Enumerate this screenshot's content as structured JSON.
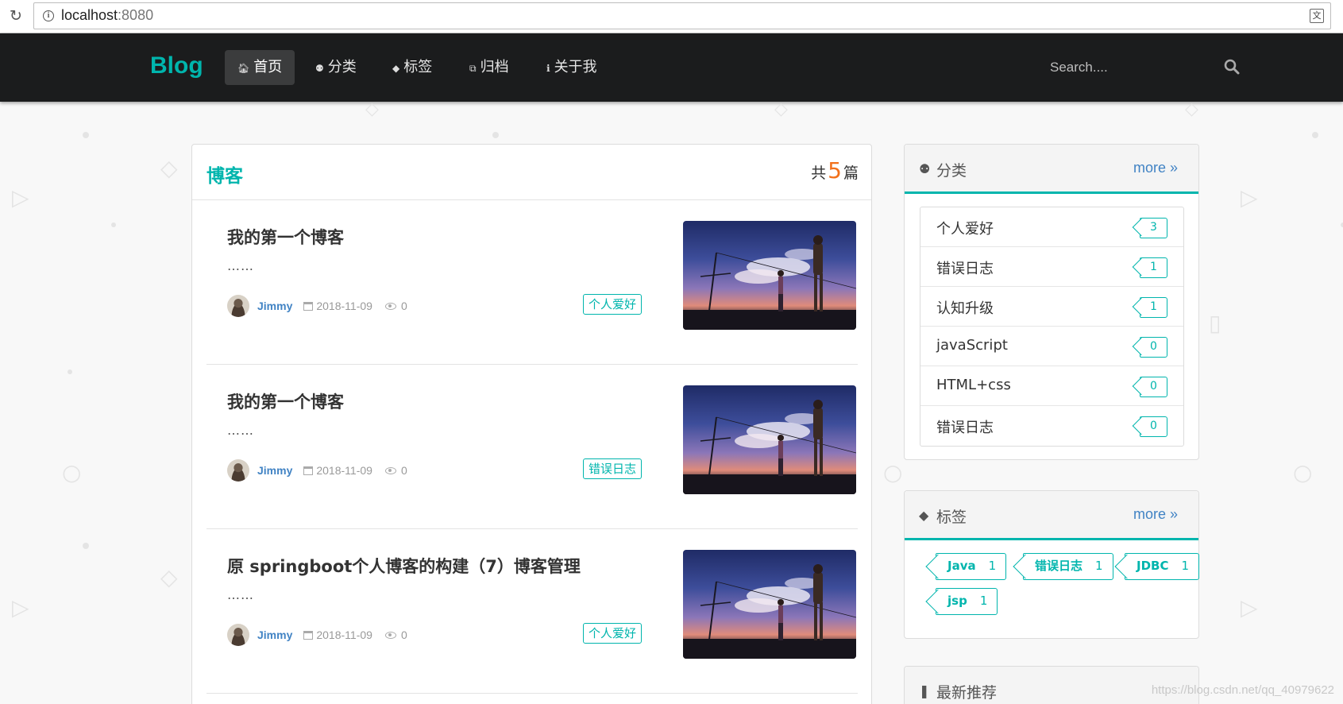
{
  "browser": {
    "url_host": "localhost",
    "url_port": ":8080"
  },
  "nav": {
    "brand": "Blog",
    "items": [
      {
        "label": "首页",
        "icon": "home-icon",
        "active": true
      },
      {
        "label": "分类",
        "icon": "idea-icon",
        "active": false
      },
      {
        "label": "标签",
        "icon": "tags-icon",
        "active": false
      },
      {
        "label": "归档",
        "icon": "clone-icon",
        "active": false
      },
      {
        "label": "关于我",
        "icon": "info-icon",
        "active": false
      }
    ],
    "search_placeholder": "Search...."
  },
  "main": {
    "title": "博客",
    "count_prefix": "共",
    "count": "5",
    "count_suffix": "篇",
    "posts": [
      {
        "title": "我的第一个博客",
        "excerpt": "……",
        "author": "Jimmy",
        "date": "2018-11-09",
        "views": "0",
        "tag": "个人爱好"
      },
      {
        "title": "我的第一个博客",
        "excerpt": "……",
        "author": "Jimmy",
        "date": "2018-11-09",
        "views": "0",
        "tag": "错误日志"
      },
      {
        "title": "原 springboot个人博客的构建（7）博客管理",
        "excerpt": "……",
        "author": "Jimmy",
        "date": "2018-11-09",
        "views": "0",
        "tag": "个人爱好"
      }
    ]
  },
  "categories": {
    "title": "分类",
    "more": "more",
    "items": [
      {
        "name": "个人爱好",
        "count": "3"
      },
      {
        "name": "错误日志",
        "count": "1"
      },
      {
        "name": "认知升级",
        "count": "1"
      },
      {
        "name": "javaScript",
        "count": "0"
      },
      {
        "name": "HTML+css",
        "count": "0"
      },
      {
        "name": "错误日志",
        "count": "0"
      }
    ]
  },
  "tags": {
    "title": "标签",
    "more": "more",
    "items": [
      {
        "name": "Java",
        "count": "1"
      },
      {
        "name": "错误日志",
        "count": "1"
      },
      {
        "name": "JDBC",
        "count": "1"
      },
      {
        "name": "jsp",
        "count": "1"
      }
    ]
  },
  "recommend": {
    "title": "最新推荐"
  },
  "watermark": "https://blog.csdn.net/qq_40979622",
  "colors": {
    "accent": "#00b5ad",
    "link": "#4183c4",
    "count": "#f2711c",
    "nav_bg": "#1b1c1d"
  }
}
